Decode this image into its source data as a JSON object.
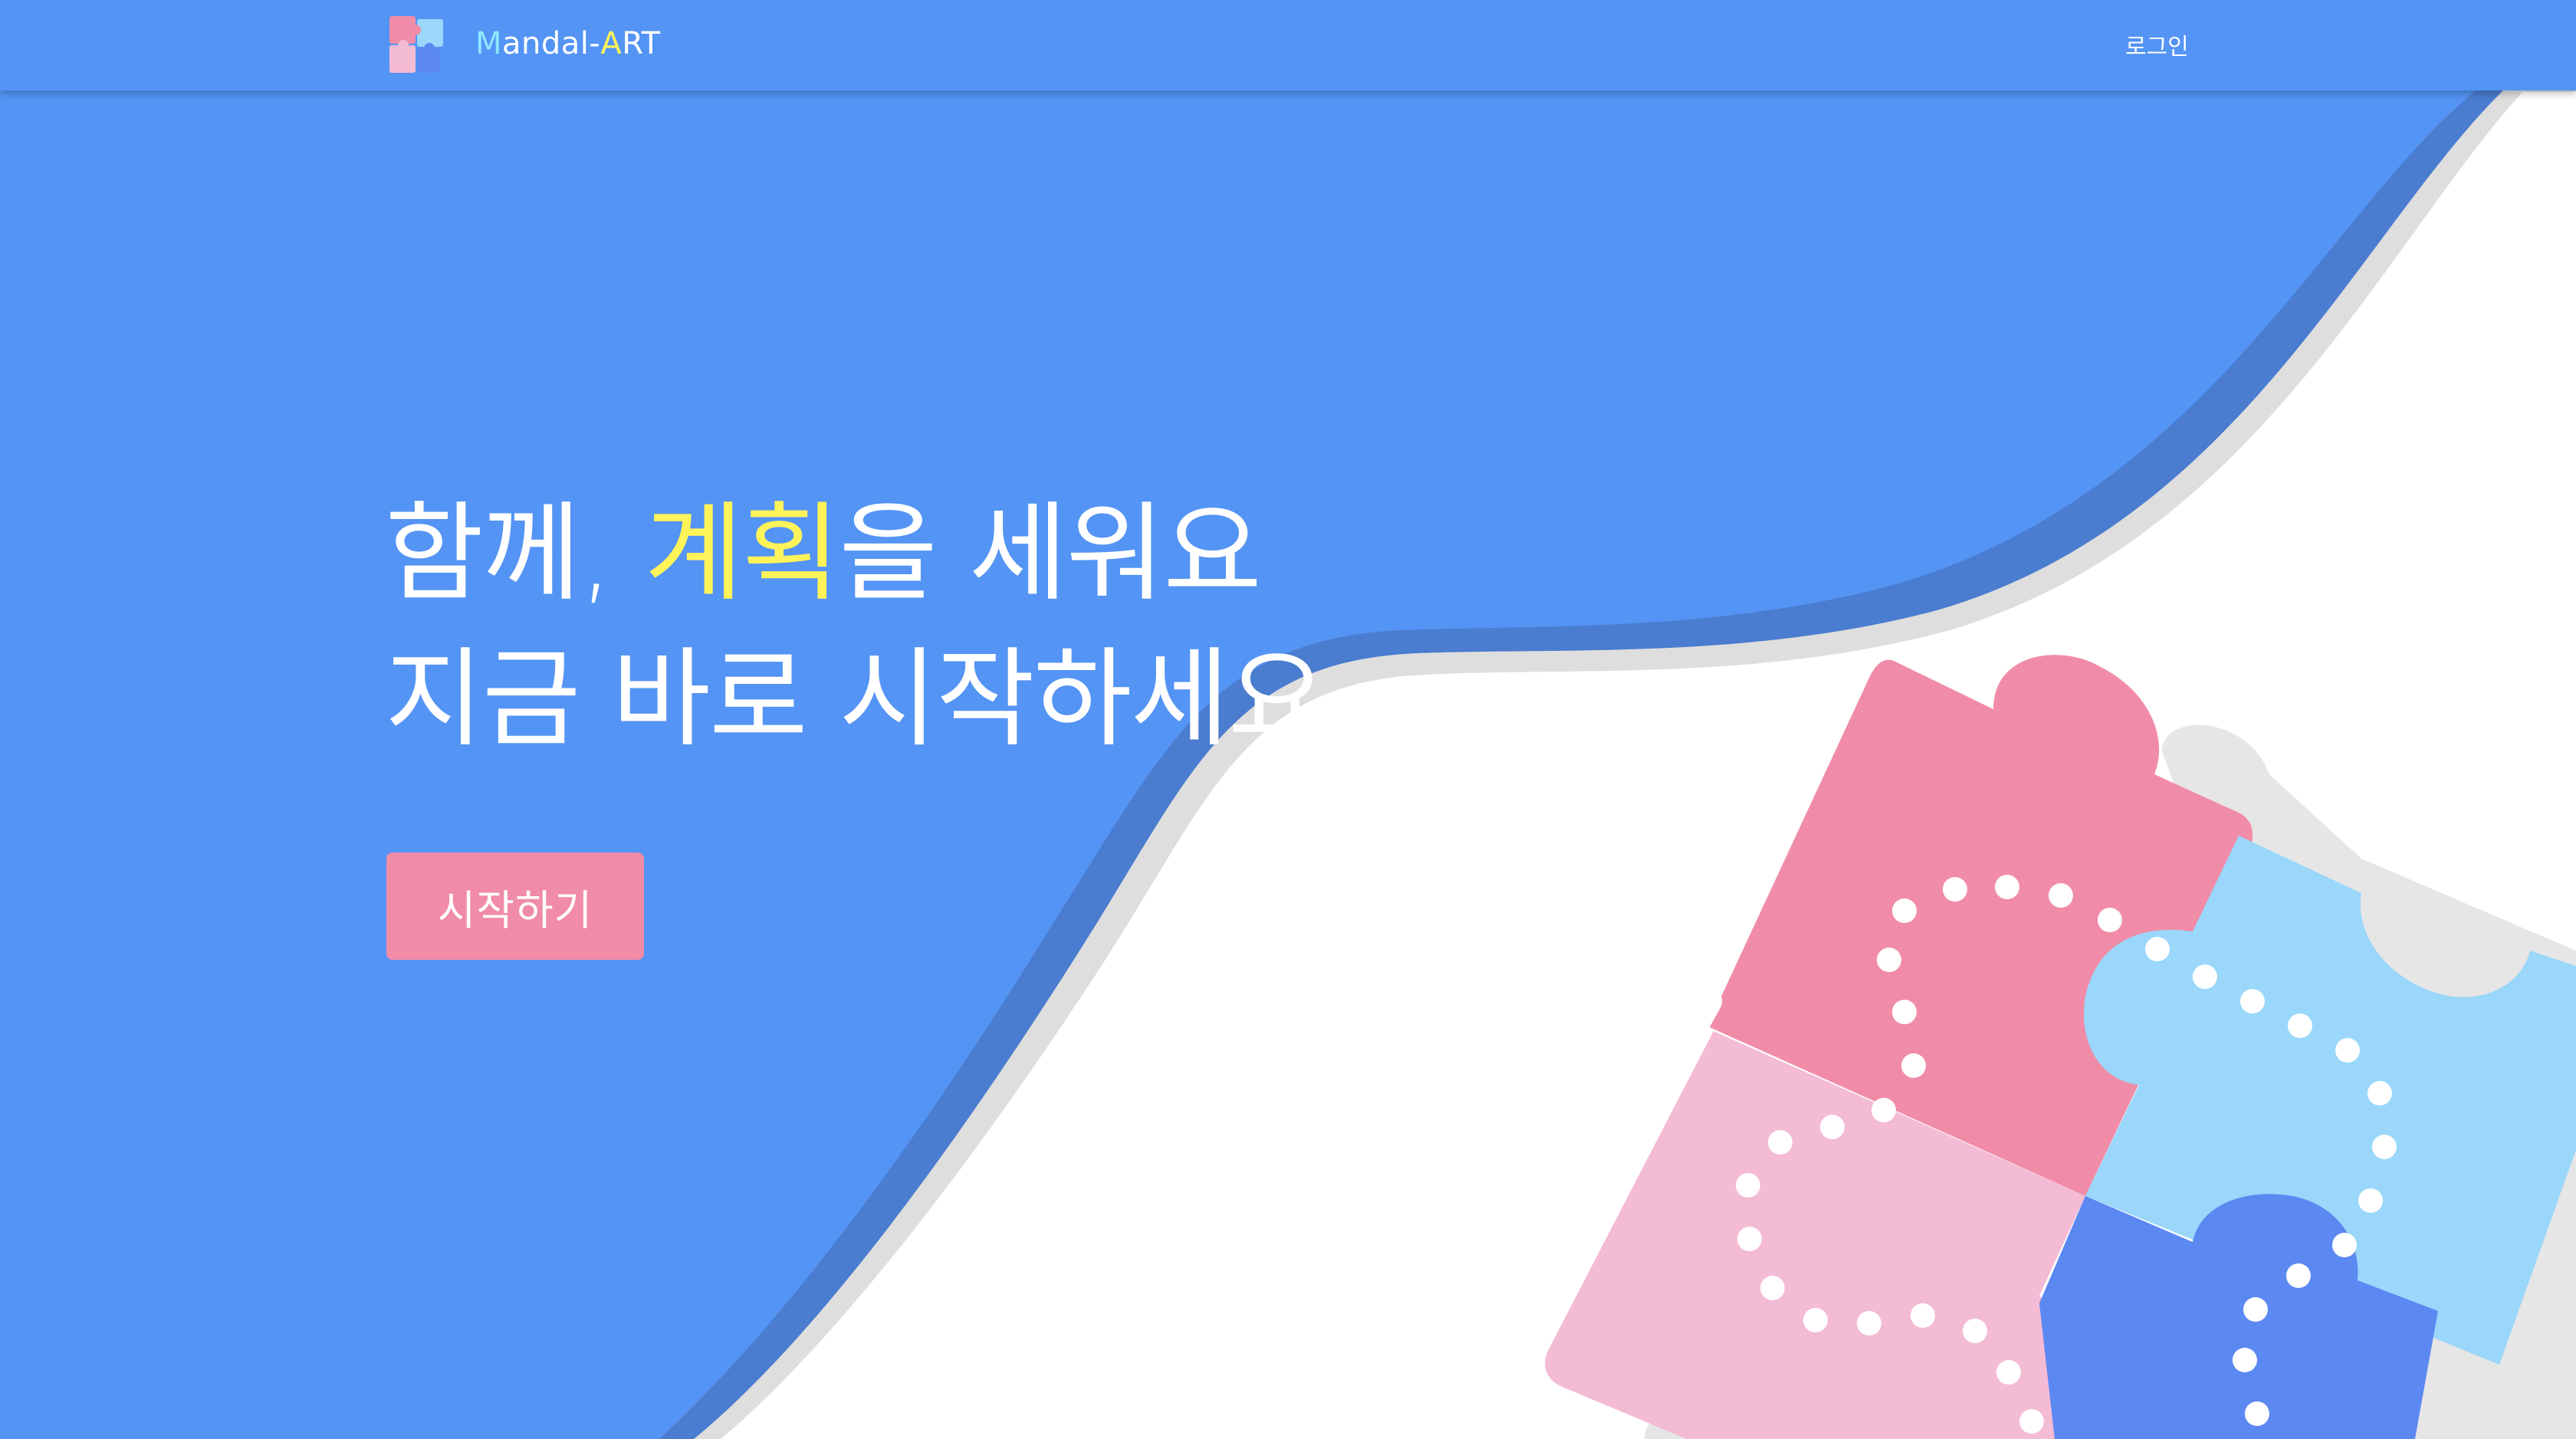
{
  "brand": {
    "name_m": "M",
    "name_mid": "andal-",
    "name_a": "A",
    "name_end": "RT",
    "logo_icon": "puzzle-logo-icon"
  },
  "nav": {
    "login_label": "로그인"
  },
  "hero": {
    "line1_pre": "함께, ",
    "line1_highlight": "계획",
    "line1_post": "을 세워요",
    "line2": "지금 바로 시작하세요"
  },
  "cta": {
    "label": "시작하기"
  },
  "illustration": {
    "icon": "puzzle-pieces-illustration"
  },
  "colors": {
    "primary_blue": "#5494f4",
    "wave_shadow": "#4a7ccf",
    "highlight_yellow": "#fff35a",
    "button_pink": "#f08ba8",
    "puzzle_pink": "#f08ca8",
    "puzzle_light_pink": "#f4bbd4",
    "puzzle_light_blue": "#9ad7fa",
    "puzzle_blue": "#5c88f2"
  }
}
